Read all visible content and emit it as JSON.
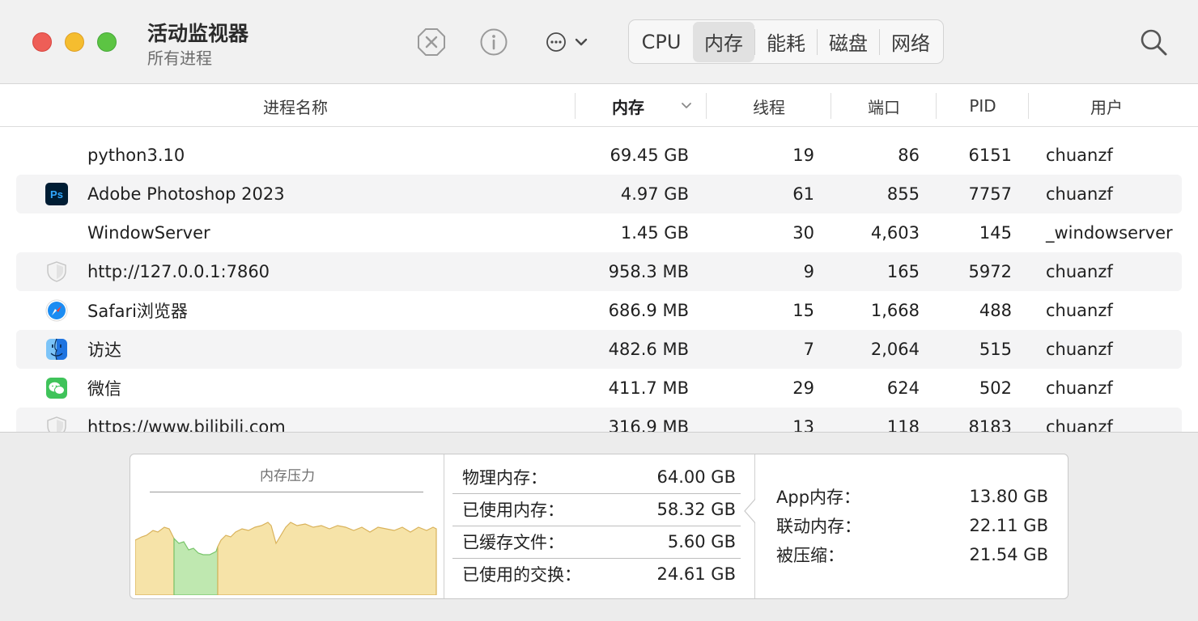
{
  "window": {
    "title": "活动监视器",
    "subtitle": "所有进程"
  },
  "toolbar": {
    "stop_icon": "x-circle-icon",
    "info_icon": "info-circle-icon",
    "more_icon": "ellipsis-circle-icon",
    "search_icon": "magnifier-icon",
    "tabs": [
      {
        "label": "CPU",
        "active": false
      },
      {
        "label": "内存",
        "active": true
      },
      {
        "label": "能耗",
        "active": false
      },
      {
        "label": "磁盘",
        "active": false
      },
      {
        "label": "网络",
        "active": false
      }
    ]
  },
  "table": {
    "columns": {
      "name": "进程名称",
      "memory": "内存",
      "threads": "线程",
      "ports": "端口",
      "pid": "PID",
      "user": "用户"
    },
    "sort_column": "memory",
    "rows": [
      {
        "icon": "",
        "name": "python3.10",
        "memory": "69.45 GB",
        "threads": "19",
        "ports": "86",
        "pid": "6151",
        "user": "chuanzf"
      },
      {
        "icon": "photoshop-icon",
        "name": "Adobe Photoshop 2023",
        "memory": "4.97 GB",
        "threads": "61",
        "ports": "855",
        "pid": "7757",
        "user": "chuanzf"
      },
      {
        "icon": "",
        "name": "WindowServer",
        "memory": "1.45 GB",
        "threads": "30",
        "ports": "4,603",
        "pid": "145",
        "user": "_windowserver"
      },
      {
        "icon": "shield-icon",
        "name": "http://127.0.0.1:7860",
        "memory": "958.3 MB",
        "threads": "9",
        "ports": "165",
        "pid": "5972",
        "user": "chuanzf"
      },
      {
        "icon": "safari-icon",
        "name": "Safari浏览器",
        "memory": "686.9 MB",
        "threads": "15",
        "ports": "1,668",
        "pid": "488",
        "user": "chuanzf"
      },
      {
        "icon": "finder-icon",
        "name": "访达",
        "memory": "482.6 MB",
        "threads": "7",
        "ports": "2,064",
        "pid": "515",
        "user": "chuanzf"
      },
      {
        "icon": "wechat-icon",
        "name": "微信",
        "memory": "411.7 MB",
        "threads": "29",
        "ports": "624",
        "pid": "502",
        "user": "chuanzf"
      },
      {
        "icon": "shield-icon",
        "name": "https://www.bilibili.com",
        "memory": "316.9 MB",
        "threads": "13",
        "ports": "118",
        "pid": "8183",
        "user": "chuanzf"
      }
    ]
  },
  "memory_pressure": {
    "label": "内存压力",
    "colors": {
      "normal": "#f6e3a8",
      "normal_line": "#d9b25b",
      "low": "#bfe8b0",
      "low_line": "#78c46a"
    }
  },
  "stats": [
    {
      "label": "物理内存：",
      "value": "64.00 GB"
    },
    {
      "label": "已使用内存：",
      "value": "58.32 GB"
    },
    {
      "label": "已缓存文件：",
      "value": "5.60 GB"
    },
    {
      "label": "已使用的交换：",
      "value": "24.61 GB"
    }
  ],
  "breakdown": [
    {
      "label": "App内存：",
      "value": "13.80 GB"
    },
    {
      "label": "联动内存：",
      "value": "22.11 GB"
    },
    {
      "label": "被压缩：",
      "value": "21.54 GB"
    }
  ]
}
